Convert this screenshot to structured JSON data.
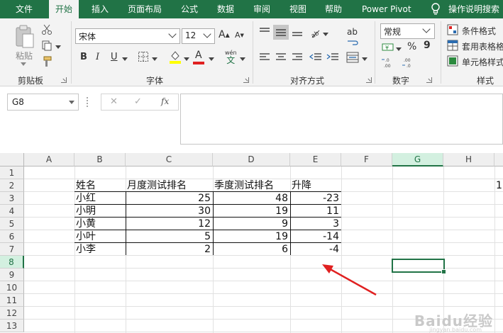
{
  "ribbon_tabs": [
    "文件",
    "开始",
    "插入",
    "页面布局",
    "公式",
    "数据",
    "审阅",
    "视图",
    "帮助",
    "Power Pivot",
    "操作说明搜索"
  ],
  "active_tab": "开始",
  "clipboard": {
    "paste_label": "粘贴",
    "group_label": "剪贴板"
  },
  "font": {
    "family": "宋体",
    "size": "12",
    "grow_glyph": "A",
    "shrink_glyph": "A",
    "bold": "B",
    "italic": "I",
    "underline": "U",
    "font_color_glyph": "A",
    "wen_glyph": "wén",
    "wen_char": "文",
    "group_label": "字体"
  },
  "alignment": {
    "group_label": "对齐方式",
    "wrap_glyph": "ab"
  },
  "number": {
    "format": "常规",
    "currency": "¥",
    "percent": "%",
    "comma": "9",
    "group_label": "数字"
  },
  "styles": {
    "conditional": "条件格式",
    "table": "套用表格格",
    "cell": "单元格样式",
    "group_label": "样式"
  },
  "formula_bar": {
    "name_box": "G8",
    "fx": "fx",
    "cancel": "✕",
    "confirm": "✓",
    "content": ""
  },
  "columns": [
    "A",
    "B",
    "C",
    "D",
    "E",
    "F",
    "G",
    "H"
  ],
  "rows": [
    "1",
    "2",
    "3",
    "4",
    "5",
    "6",
    "7",
    "8",
    "9",
    "10",
    "11",
    "12",
    "13"
  ],
  "selected_cell": "G8",
  "table": {
    "headers": [
      "姓名",
      "月度测试排名",
      "季度测试排名",
      "升降"
    ],
    "rows": [
      [
        "小红",
        "25",
        "48",
        "-23"
      ],
      [
        "小明",
        "30",
        "19",
        "11"
      ],
      [
        "小黄",
        "12",
        "9",
        "3"
      ],
      [
        "小叶",
        "5",
        "19",
        "-14"
      ],
      [
        "小李",
        "2",
        "6",
        "-4"
      ]
    ]
  },
  "offscreen_value_i2": "1",
  "watermark": "Baidu经验",
  "watermark_sub": "jingyan.baidu.com",
  "colors": {
    "accent": "#217346",
    "arrow": "#e02020"
  }
}
